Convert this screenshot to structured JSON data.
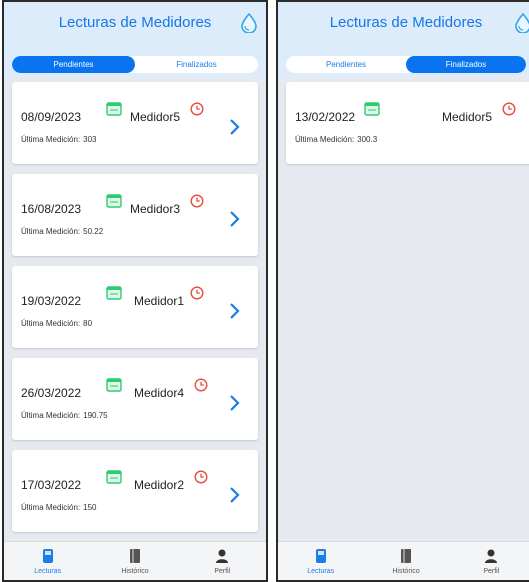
{
  "header": {
    "title": "Lecturas de Medidores"
  },
  "tabs": {
    "pending": "Pendientes",
    "finished": "Finalizados"
  },
  "last_label": "Última Medición:",
  "pending_items": [
    {
      "date": "08/09/2023",
      "meter": "Medidor5",
      "last": "303"
    },
    {
      "date": "16/08/2023",
      "meter": "Medidor3",
      "last": "50.22"
    },
    {
      "date": "19/03/2022",
      "meter": "Medidor1",
      "last": "80"
    },
    {
      "date": "26/03/2022",
      "meter": "Medidor4",
      "last": "190.75"
    },
    {
      "date": "17/03/2022",
      "meter": "Medidor2",
      "last": "150"
    }
  ],
  "finished_items": [
    {
      "date": "13/02/2022",
      "meter": "Medidor5",
      "last": "300.3"
    }
  ],
  "nav": {
    "readings": "Lecturas",
    "history": "Histórico",
    "profile": "Perfil"
  },
  "colors": {
    "accent": "#0a74f0",
    "header_bg": "#dcecfb",
    "calendar": "#2ecc71",
    "clock": "#e74c3c"
  }
}
